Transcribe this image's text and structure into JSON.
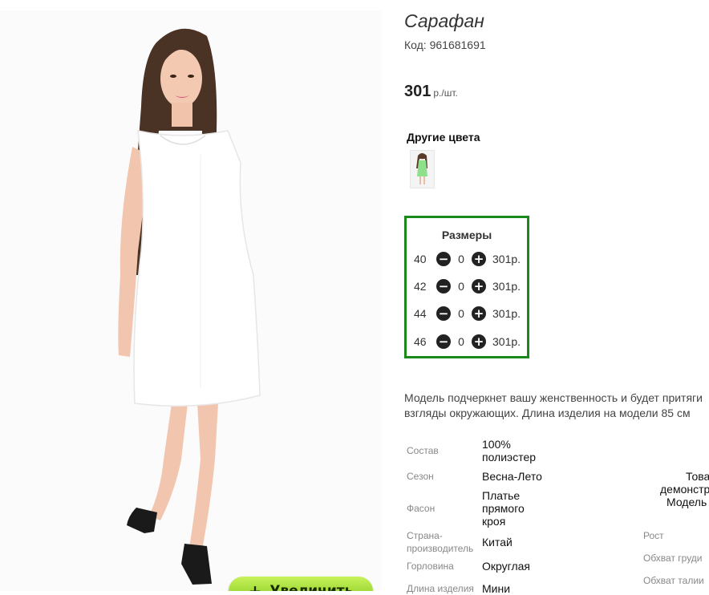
{
  "product": {
    "title": "Сарафан",
    "code": "Код: 961681691",
    "price": "301",
    "price_unit": "р./шт."
  },
  "other_colors": {
    "heading": "Другие цвета",
    "swatches": [
      {
        "color": "#8fe08a"
      }
    ]
  },
  "sizes": {
    "heading": "Размеры",
    "rows": [
      {
        "size": "40",
        "qty": "0",
        "price": "301р."
      },
      {
        "size": "42",
        "qty": "0",
        "price": "301р."
      },
      {
        "size": "44",
        "qty": "0",
        "price": "301р."
      },
      {
        "size": "46",
        "qty": "0",
        "price": "301р."
      }
    ]
  },
  "description": {
    "line1": "Модель подчеркнет вашу женственность и будет притяги",
    "line2": "взгляды окружающих. Длина изделия на модели 85 см"
  },
  "specs": {
    "composition_label": "Состав",
    "composition_l1": "100%",
    "composition_l2": "полиэстер",
    "season_label": "Сезон",
    "season_value": "Весна-Лето",
    "style_label": "Фасон",
    "style_l1": "Платье",
    "style_l2": "прямого",
    "style_l3": "кроя",
    "country_label_l1": "Страна-",
    "country_label_l2": "производитель",
    "country_value": "Китай",
    "neckline_label": "Горловина",
    "neckline_value": "Округлая",
    "length_label": "Длина изделия",
    "length_value": "Мини"
  },
  "right_col": {
    "line1": "Това",
    "line2": "демонстр",
    "line3": "Модель",
    "height_label": "Рост",
    "chest_label": "Обхват груди",
    "waist_label": "Обхват талии"
  },
  "zoom_button": {
    "icon": "plus-icon",
    "label": "Увеличить"
  },
  "colors": {
    "accent_border": "#1a8a1a",
    "zoom_button": "#9bd42c"
  }
}
